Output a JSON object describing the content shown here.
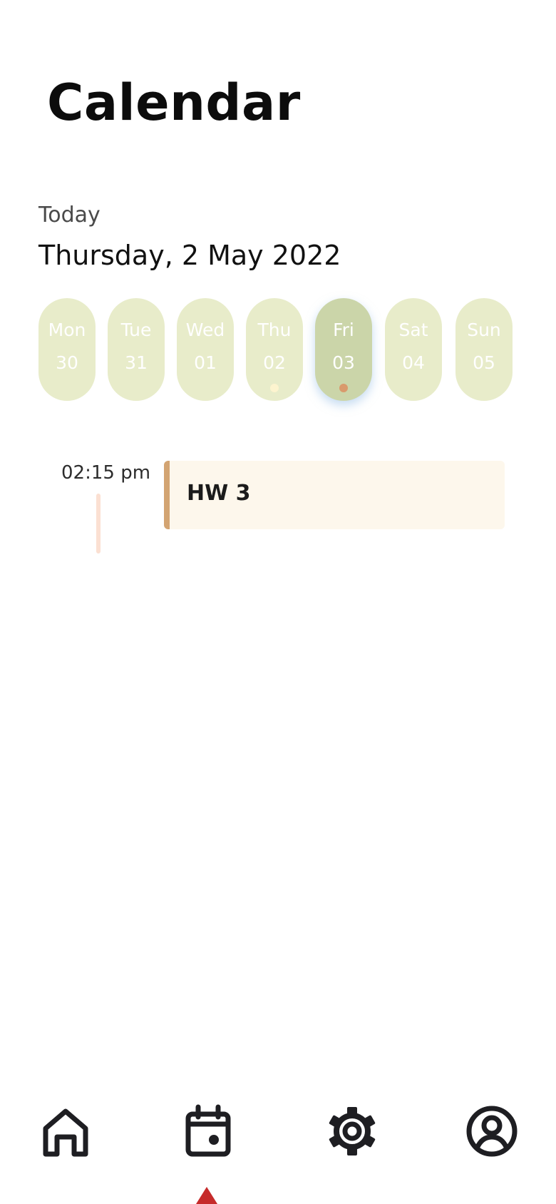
{
  "header": {
    "title": "Calendar"
  },
  "today": {
    "label": "Today",
    "date": "Thursday, 2 May 2022"
  },
  "week": {
    "days": [
      {
        "name": "Mon",
        "num": "30",
        "selected": false,
        "dot": null
      },
      {
        "name": "Tue",
        "num": "31",
        "selected": false,
        "dot": null
      },
      {
        "name": "Wed",
        "num": "01",
        "selected": false,
        "dot": null
      },
      {
        "name": "Thu",
        "num": "02",
        "selected": false,
        "dot": "#fdf4cf"
      },
      {
        "name": "Fri",
        "num": "03",
        "selected": true,
        "dot": "#d99a6c"
      },
      {
        "name": "Sat",
        "num": "04",
        "selected": false,
        "dot": null
      },
      {
        "name": "Sun",
        "num": "05",
        "selected": false,
        "dot": null
      }
    ]
  },
  "events": [
    {
      "time": "02:15 pm",
      "title": "HW 3"
    }
  ],
  "nav": {
    "items": [
      {
        "icon": "home-icon",
        "active": false
      },
      {
        "icon": "calendar-icon",
        "active": true
      },
      {
        "icon": "gear-icon",
        "active": false
      },
      {
        "icon": "profile-icon",
        "active": false
      }
    ],
    "indicator_color": "#c62b2b"
  },
  "colors": {
    "pill": "#e8ecca",
    "pill_selected": "#cbd5a9",
    "event_bg": "#fdf7ec",
    "event_accent": "#d3a472",
    "time_bar": "#fbe0d2"
  }
}
